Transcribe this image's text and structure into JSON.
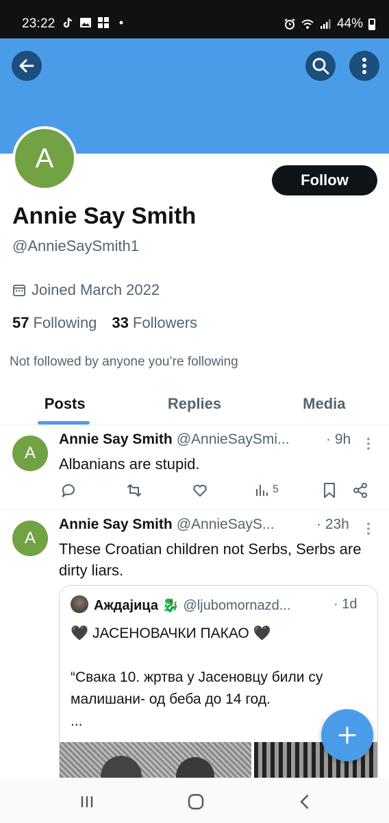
{
  "status_bar": {
    "time": "23:22",
    "battery": "44%",
    "icons": [
      "tiktok-icon",
      "image-icon",
      "windows-icon",
      "dot-icon",
      "alarm-icon",
      "wifi-icon",
      "signal-icon",
      "battery-icon"
    ]
  },
  "header": {
    "banner_color": "#4a9ce8",
    "back_icon": "arrow-left-icon",
    "search_icon": "search-icon",
    "more_icon": "more-vertical-icon"
  },
  "profile": {
    "avatar_letter": "A",
    "avatar_color": "#72a244",
    "follow_label": "Follow",
    "display_name": "Annie Say Smith",
    "handle": "@AnnieSaySmith1",
    "joined": "Joined March 2022",
    "following_count": "57",
    "following_label": "Following",
    "followers_count": "33",
    "followers_label": "Followers",
    "not_followed_text": "Not followed by anyone you’re following"
  },
  "tabs": [
    {
      "label": "Posts",
      "active": true
    },
    {
      "label": "Replies",
      "active": false
    },
    {
      "label": "Media",
      "active": false
    }
  ],
  "posts": [
    {
      "avatar_letter": "A",
      "name": "Annie Say Smith",
      "handle": "@AnnieSaySmi...",
      "time": "· 9h",
      "text": "Albanians are stupid.",
      "views": "5"
    },
    {
      "avatar_letter": "A",
      "name": "Annie Say Smith",
      "handle": "@AnnieSayS...",
      "time": "· 23h",
      "text": "These Croatian children not Serbs, Serbs are dirty liars.",
      "quote": {
        "name": "Аждајица 🐉",
        "handle": "@ljubomornazd...",
        "time": "· 1d",
        "line1": "🖤 ЈАСЕНОВАЧКИ ПАКАО 🖤",
        "line2": "“Свака 10. жртва у Јасеновцу били су малишани- од беба до 14 год.",
        "line3": "..."
      }
    }
  ],
  "fab": {
    "icon": "plus-icon"
  },
  "nav": {
    "icons": [
      "recent-apps-icon",
      "home-icon",
      "back-icon"
    ]
  }
}
